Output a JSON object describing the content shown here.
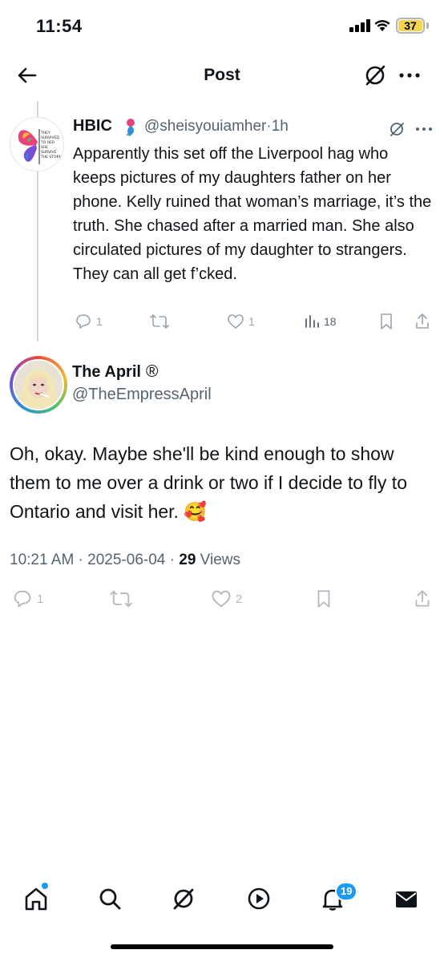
{
  "status_bar": {
    "time": "11:54",
    "battery": "37"
  },
  "header": {
    "title": "Post"
  },
  "parent_tweet": {
    "name": "HBIC",
    "handle": "@sheisyouiamher",
    "time": "1h",
    "text": "Apparently this set off the Liverpool hag who keeps pictures of my daughters father on her phone. Kelly ruined that woman’s marriage, it’s the truth. She chased after a married man. She also circulated pictures of my daughter to strangers. They can all get f’cked.",
    "avatar_words": "THEY SURVIVED TO HER SHE SURVIVE THE STORM I AM THE STORM",
    "actions": {
      "replies": "1",
      "reposts": "",
      "likes": "1",
      "views": "18"
    }
  },
  "main_tweet": {
    "name": "The April",
    "name_suffix": "®",
    "handle": "@TheEmpressApril",
    "text": "Oh, okay. Maybe she'll be kind enough to show them to me over a drink or two if I decide to fly to Ontario and visit her. 🥰",
    "timestamp": "10:21 AM · 2025-06-04 · ",
    "views_count": "29",
    "views_label": " Views",
    "actions": {
      "replies": "1",
      "reposts": "",
      "likes": "2"
    }
  },
  "bottom_nav": {
    "notification_count": "19"
  },
  "colors": {
    "accent": "#1d9bf0",
    "text": "#0f1419",
    "secondary": "#536471",
    "icon_muted": "#9aa4ad"
  }
}
